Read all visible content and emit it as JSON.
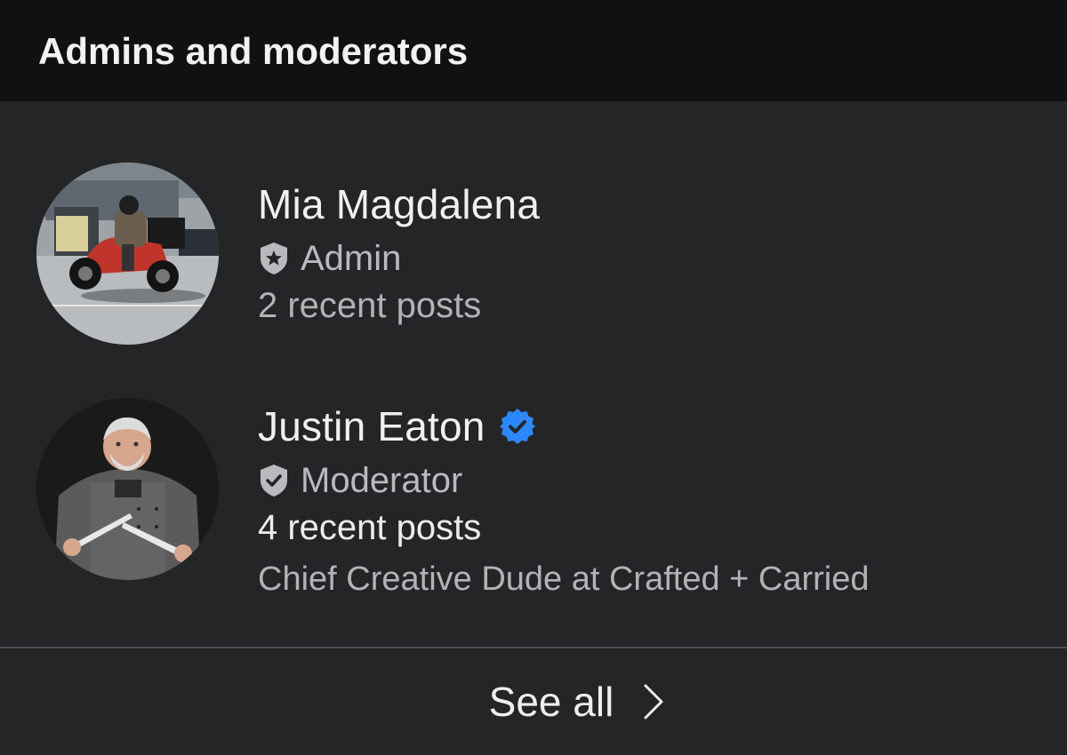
{
  "header": {
    "title": "Admins and moderators"
  },
  "members": [
    {
      "name": "Mia Magdalena",
      "role_icon": "shield-star-icon",
      "role": "Admin",
      "recent_posts": "2 recent posts",
      "avatar": "motorcycle-rider-avatar",
      "verified": false
    },
    {
      "name": "Justin Eaton",
      "verified_icon": "verified-badge-icon",
      "verified": true,
      "verified_color": "#2d88ff",
      "role_icon": "shield-check-icon",
      "role": "Moderator",
      "recent_posts": "4 recent posts",
      "subtitle": "Chief Creative Dude at Crafted + Carried",
      "avatar": "chef-with-knives-avatar"
    }
  ],
  "footer": {
    "see_all_label": "See all",
    "chevron_icon": "chevron-right-icon"
  },
  "colors": {
    "background": "#242526",
    "header_background": "#111112",
    "primary_text": "#f0f0f0",
    "secondary_text": "#b0b3b8",
    "accent": "#2d88ff"
  }
}
